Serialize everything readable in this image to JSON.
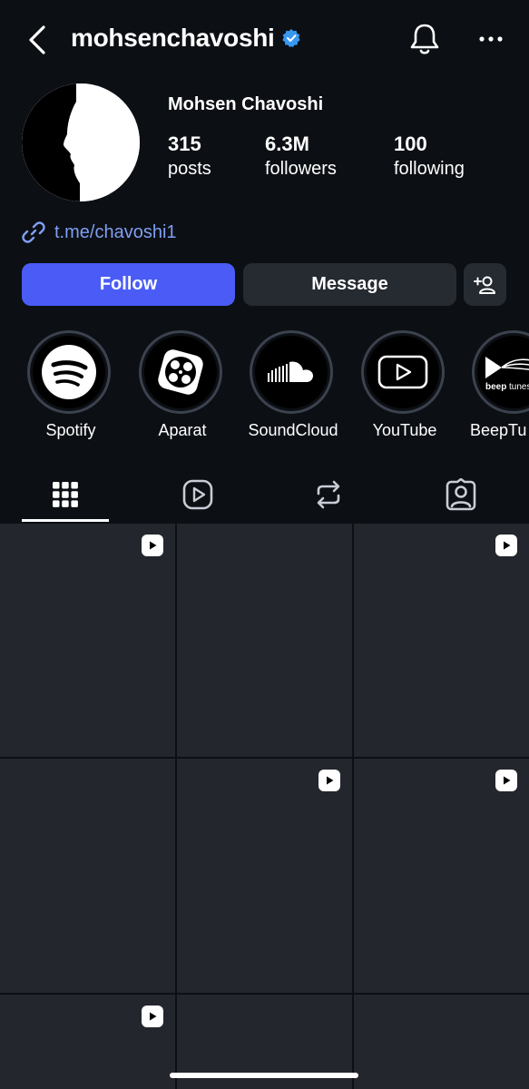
{
  "header": {
    "username": "mohsenchavoshi",
    "back_icon": "chevron-left-icon",
    "notifications_icon": "bell-icon",
    "more_icon": "more-horizontal-icon",
    "verified_color": "#3897f0"
  },
  "profile": {
    "display_name": "Mohsen Chavoshi",
    "stats": {
      "posts": {
        "value": "315",
        "label": "posts"
      },
      "followers": {
        "value": "6.3M",
        "label": "followers"
      },
      "following": {
        "value": "100",
        "label": "following"
      }
    },
    "link": "t.me/chavoshi1",
    "link_color": "#7f9ff2"
  },
  "actions": {
    "follow_label": "Follow",
    "message_label": "Message",
    "follow_color": "#4a5cf5"
  },
  "highlights": [
    {
      "label": "Spotify",
      "icon": "spotify-icon"
    },
    {
      "label": "Aparat",
      "icon": "aparat-icon"
    },
    {
      "label": "SoundCloud",
      "icon": "soundcloud-icon"
    },
    {
      "label": "YouTube",
      "icon": "youtube-icon"
    },
    {
      "label": "BeepTu",
      "icon": "beeptunes-icon",
      "logo_text": "beep tunes"
    }
  ],
  "tabs": [
    {
      "name": "posts-grid",
      "icon": "grid-icon",
      "active": true
    },
    {
      "name": "reels",
      "icon": "reels-icon",
      "active": false
    },
    {
      "name": "reposts",
      "icon": "repost-icon",
      "active": false
    },
    {
      "name": "tagged",
      "icon": "tagged-icon",
      "active": false
    }
  ],
  "grid": {
    "rows": [
      [
        {
          "reel": true
        },
        {
          "reel": false
        },
        {
          "reel": true
        }
      ],
      [
        {
          "reel": false
        },
        {
          "reel": true
        },
        {
          "reel": true
        }
      ],
      [
        {
          "reel": true
        },
        {
          "reel": false
        },
        {
          "reel": false
        }
      ]
    ]
  }
}
